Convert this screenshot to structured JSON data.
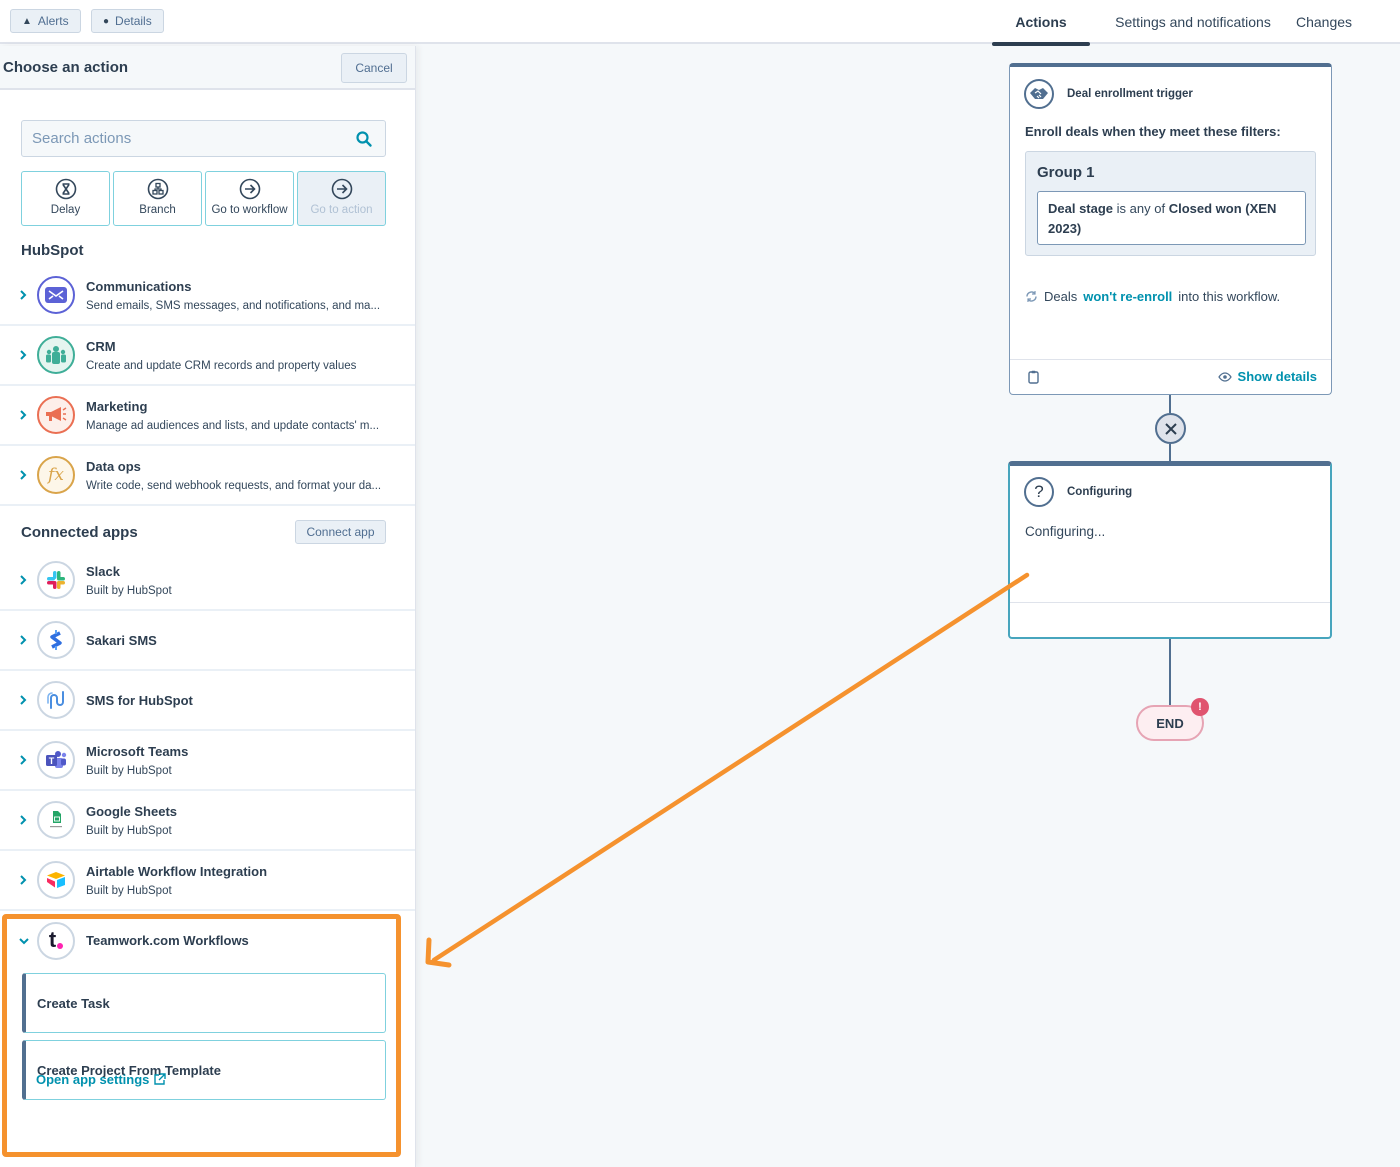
{
  "topbar": {
    "alerts_label": "Alerts",
    "details_label": "Details",
    "tabs": [
      {
        "label": "Actions",
        "active": true
      },
      {
        "label": "Settings and notifications",
        "active": false
      },
      {
        "label": "Changes",
        "active": false
      }
    ]
  },
  "panel": {
    "title": "Choose an action",
    "cancel_label": "Cancel",
    "search_placeholder": "Search actions",
    "quick_actions": [
      {
        "label": "Delay",
        "icon": "hourglass-icon",
        "disabled": false
      },
      {
        "label": "Branch",
        "icon": "branch-icon",
        "disabled": false
      },
      {
        "label": "Go to workflow",
        "icon": "arrow-right-circle-icon",
        "disabled": false
      },
      {
        "label": "Go to action",
        "icon": "arrow-right-circle-icon",
        "disabled": true
      }
    ],
    "hubspot_heading": "HubSpot",
    "hubspot_items": [
      {
        "name": "Communications",
        "desc": "Send emails, SMS messages, and notifications, and ma...",
        "icon": "envelope-icon",
        "color": "#5c62d6"
      },
      {
        "name": "CRM",
        "desc": "Create and update CRM records and property values",
        "icon": "people-icon",
        "color": "#3fae98"
      },
      {
        "name": "Marketing",
        "desc": "Manage ad audiences and lists, and update contacts' m...",
        "icon": "megaphone-icon",
        "color": "#ea6f53"
      },
      {
        "name": "Data ops",
        "desc": "Write code, send webhook requests, and format your da...",
        "icon": "function-icon",
        "color": "#d9a44a"
      }
    ],
    "connected_heading": "Connected apps",
    "connect_app_label": "Connect app",
    "connected_items": [
      {
        "name": "Slack",
        "desc": "Built by HubSpot",
        "icon": "slack-icon"
      },
      {
        "name": "Sakari SMS",
        "desc": "",
        "icon": "sakari-icon"
      },
      {
        "name": "SMS for HubSpot",
        "desc": "",
        "icon": "sms-hubspot-icon"
      },
      {
        "name": "Microsoft Teams",
        "desc": "Built by HubSpot",
        "icon": "teams-icon"
      },
      {
        "name": "Google Sheets",
        "desc": "Built by HubSpot",
        "icon": "google-sheets-icon"
      },
      {
        "name": "Airtable Workflow Integration",
        "desc": "Built by HubSpot",
        "icon": "airtable-icon"
      }
    ],
    "expanded_app": {
      "name": "Teamwork.com Workflows",
      "icon": "teamwork-icon",
      "actions": [
        "Create Task",
        "Create Project From Template"
      ],
      "settings_link": "Open app settings"
    }
  },
  "canvas": {
    "trigger": {
      "title": "Deal enrollment trigger",
      "enroll_text": "Enroll deals when they meet these filters:",
      "group_title": "Group 1",
      "filter": {
        "property": "Deal stage",
        "operator": "is any of",
        "value": "Closed won (XEN 2023)"
      },
      "reenroll_prefix": "Deals",
      "reenroll_link": "won't re-enroll",
      "reenroll_suffix": "into this workflow.",
      "show_details": "Show details"
    },
    "configuring": {
      "title": "Configuring",
      "body": "Configuring..."
    },
    "end_label": "END",
    "end_badge": "!"
  },
  "colors": {
    "accent": "#0091ae",
    "highlight": "#f5922e",
    "dark": "#2d3e50",
    "error": "#e0546f"
  }
}
